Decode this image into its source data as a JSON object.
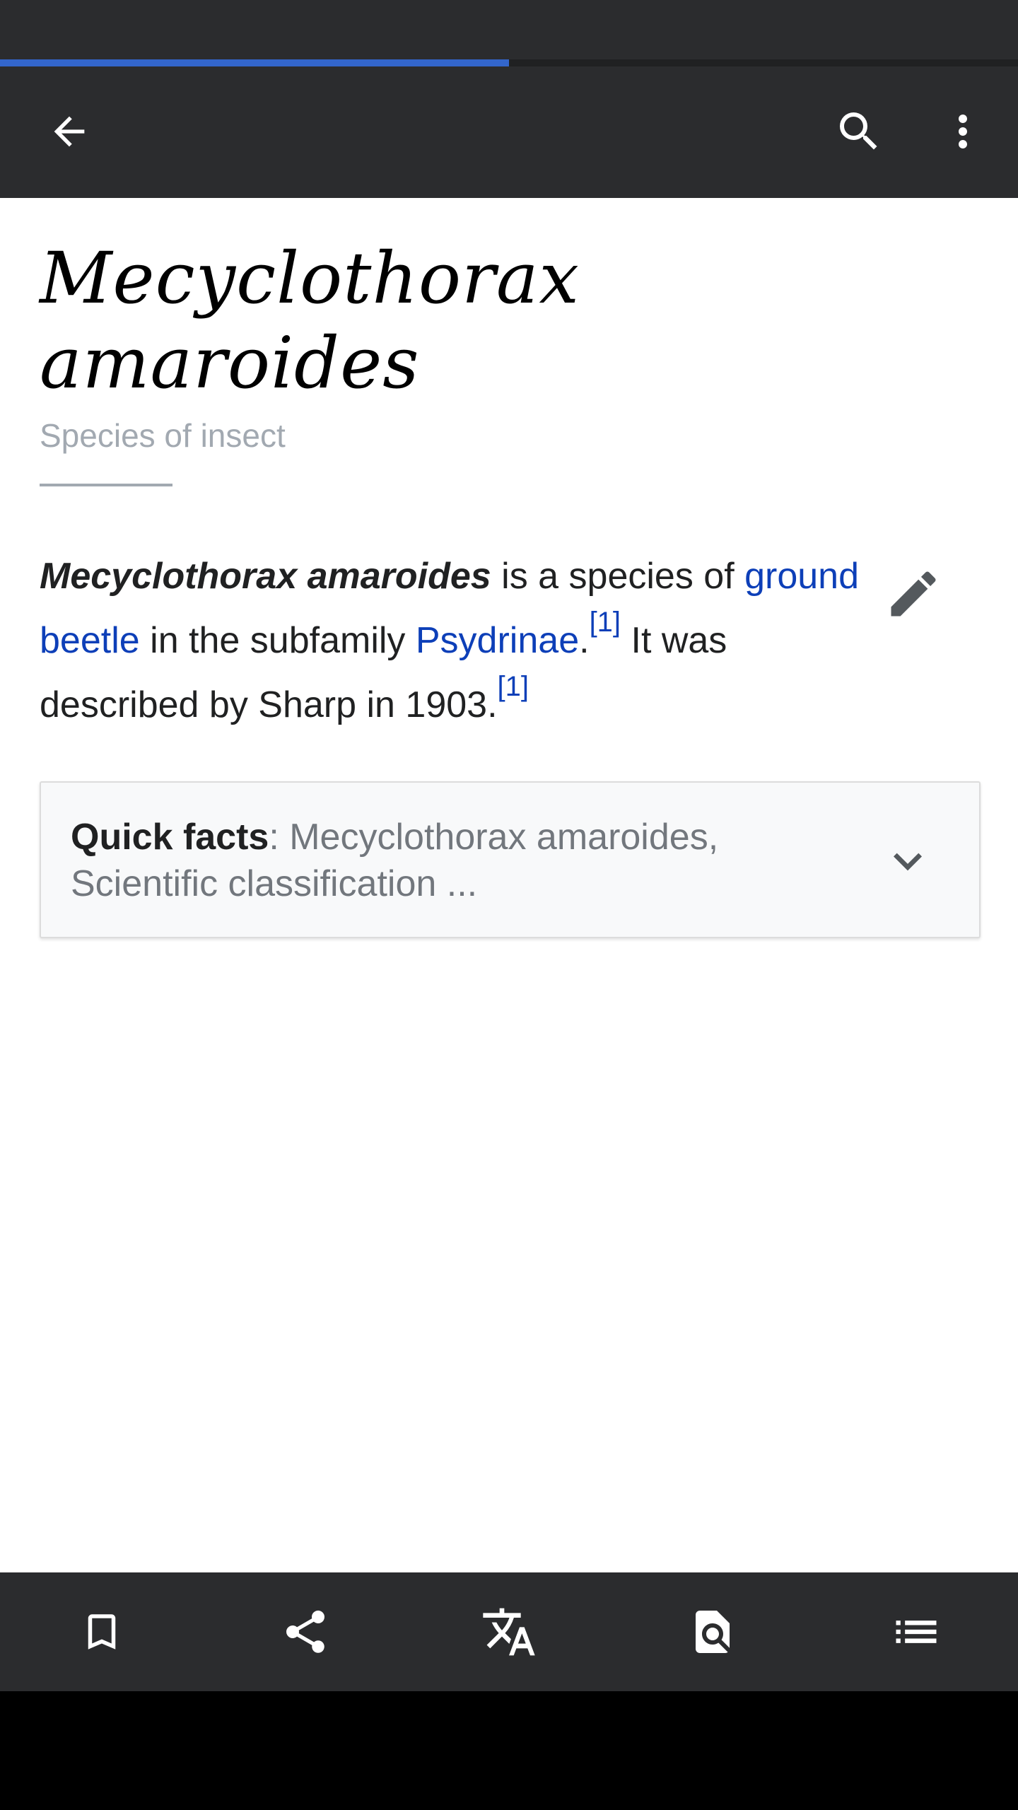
{
  "progress": {
    "fraction": 0.5,
    "color": "#3366cc"
  },
  "toolbar": {
    "back_icon": "arrow-left-icon",
    "search_icon": "search-icon",
    "more_icon": "more-vertical-icon"
  },
  "article": {
    "title": "Mecyclothorax amaroides",
    "subtitle": "Species of insect",
    "intro": {
      "bold_name": "Mecyclothorax amaroides",
      "text_1": " is a species of ",
      "link_ground_beetle": "ground beetle",
      "text_2": " in the subfamily ",
      "link_psydrinae": "Psydrinae",
      "text_3": ".",
      "ref_1": "[1]",
      "text_4": " It was described by Sharp in 1903.",
      "ref_2": "[1]"
    },
    "edit_icon": "pencil-icon"
  },
  "quick_facts": {
    "label": "Quick facts",
    "summary": ": Mecyclothorax amaroides, Scientific classification ...",
    "chevron_icon": "chevron-down-icon"
  },
  "bottom_bar": {
    "items": [
      {
        "name": "save",
        "icon": "bookmark-icon"
      },
      {
        "name": "share",
        "icon": "share-icon"
      },
      {
        "name": "language",
        "icon": "translate-icon"
      },
      {
        "name": "find-in-page",
        "icon": "find-in-page-icon"
      },
      {
        "name": "contents",
        "icon": "table-of-contents-icon"
      }
    ]
  },
  "colors": {
    "toolbar_bg": "#2b2c2e",
    "link": "#0d3fb8",
    "text": "#202122",
    "muted": "#a2a9b1"
  }
}
